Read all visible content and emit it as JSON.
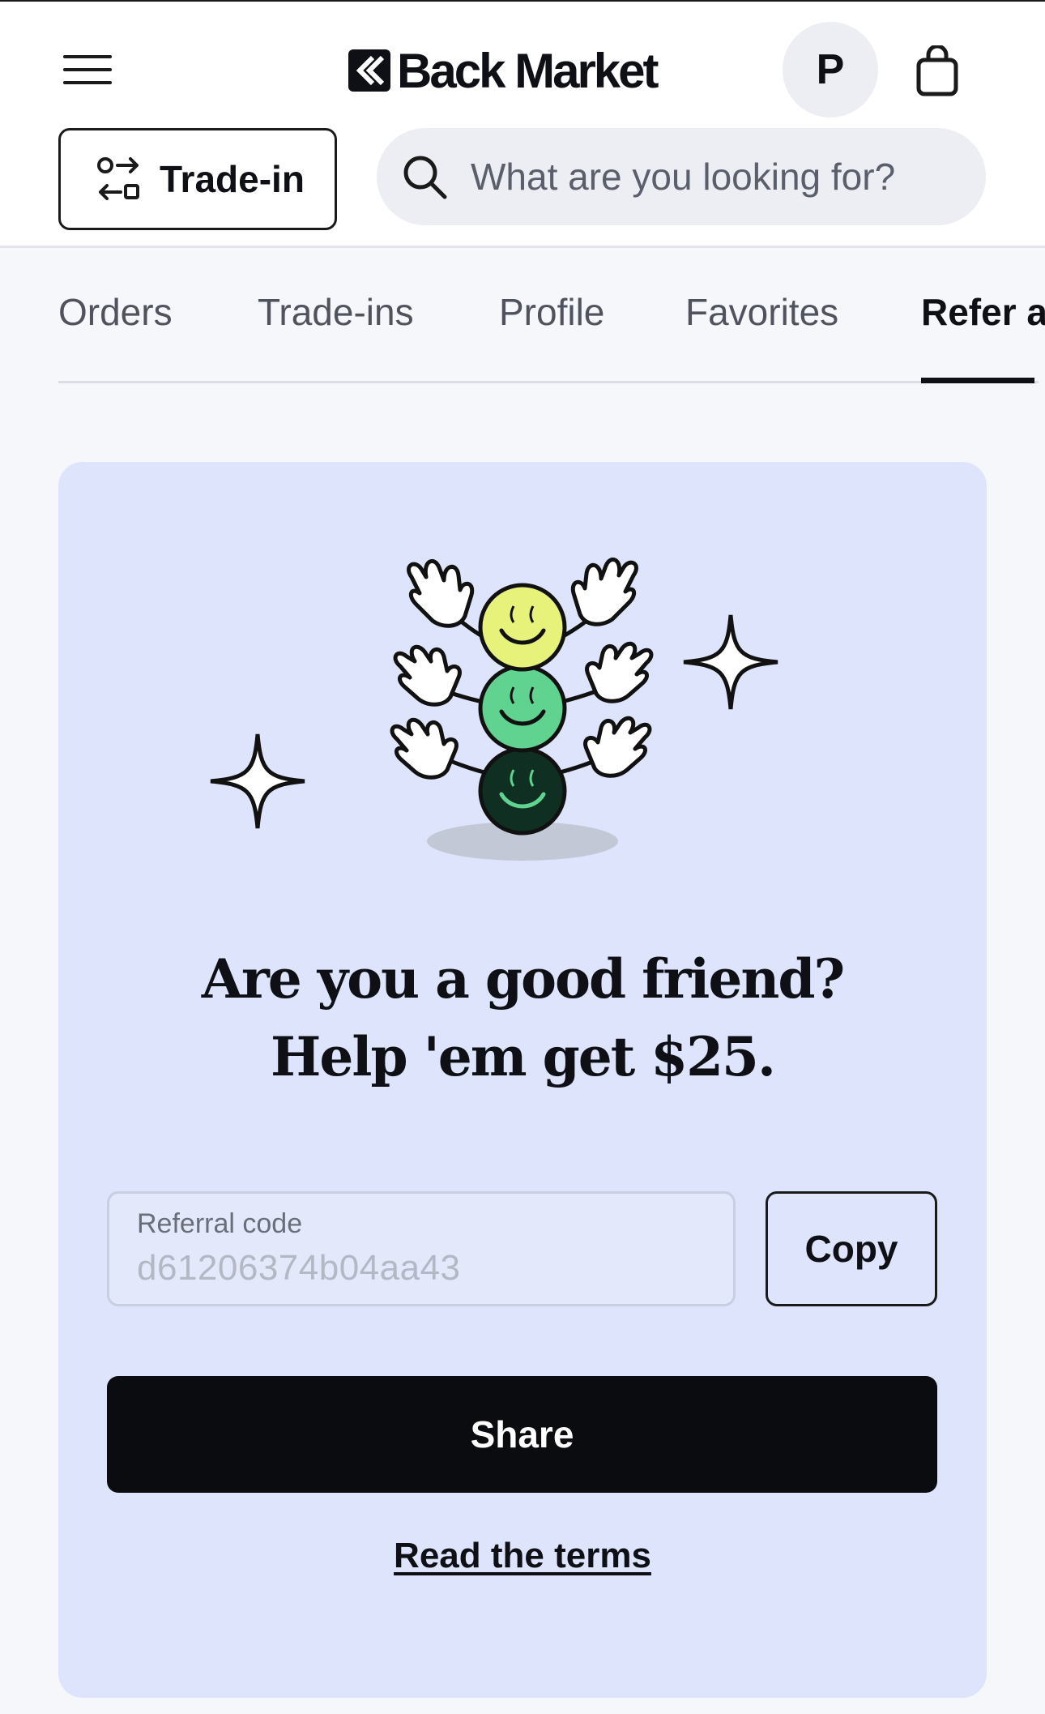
{
  "header": {
    "logo_text": "Back Market",
    "avatar_initial": "P",
    "trade_in_label": "Trade-in",
    "search_placeholder": "What are you looking for?"
  },
  "tabs": [
    {
      "label": "Orders",
      "active": false
    },
    {
      "label": "Trade-ins",
      "active": false
    },
    {
      "label": "Profile",
      "active": false
    },
    {
      "label": "Favorites",
      "active": false
    },
    {
      "label": "Refer a",
      "active": true
    }
  ],
  "referral": {
    "headline_line1": "Are you a good friend?",
    "headline_line2": "Help 'em get $25.",
    "code_label": "Referral code",
    "code_value": "d61206374b04aa43",
    "copy_label": "Copy",
    "share_label": "Share",
    "terms_label": "Read the terms"
  },
  "icons": {
    "menu": "hamburger-menu-icon",
    "logo": "back-market-logo-icon",
    "cart": "shopping-bag-icon",
    "trade_in": "trade-in-arrows-icon",
    "search": "search-icon",
    "sparkle": "sparkle-icon"
  },
  "colors": {
    "card_background": "#dde4fb",
    "share_button": "#0b0c10",
    "smiley_yellow": "#e6f27a",
    "smiley_green": "#5fd38f",
    "smiley_dark": "#0f2f22"
  }
}
